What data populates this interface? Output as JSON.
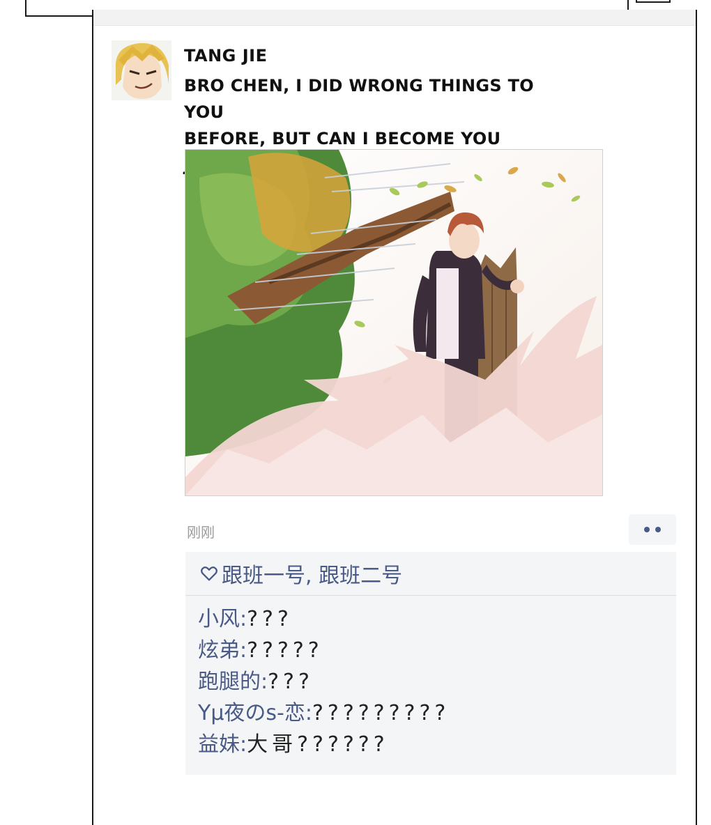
{
  "post": {
    "username": "TANG JIE",
    "text_line1": "BRO CHEN, I DID WRONG THINGS TO YOU",
    "text_line2": "BEFORE, BUT CAN I BECOME YOU JUNIOR?",
    "timestamp": "刚刚",
    "likes": "跟班一号, 跟班二号",
    "comments": [
      {
        "author": "小风",
        "sep": ":",
        "text": "???"
      },
      {
        "author": "炫弟",
        "sep": ":",
        "text": "?????"
      },
      {
        "author": "跑腿的",
        "sep": ":",
        "text": "???"
      },
      {
        "author": "Yμ夜のs-恋",
        "sep": ":",
        "text": "?????????"
      },
      {
        "author": "益妹",
        "sep": ":",
        "text": "大哥??????"
      }
    ]
  },
  "icons": {
    "more": "more-dots-icon",
    "like": "heart-outline-icon"
  },
  "colors": {
    "name_blue": "#4a5a86",
    "box_bg": "#f4f5f7",
    "timestamp_gray": "#9a9a9a"
  }
}
